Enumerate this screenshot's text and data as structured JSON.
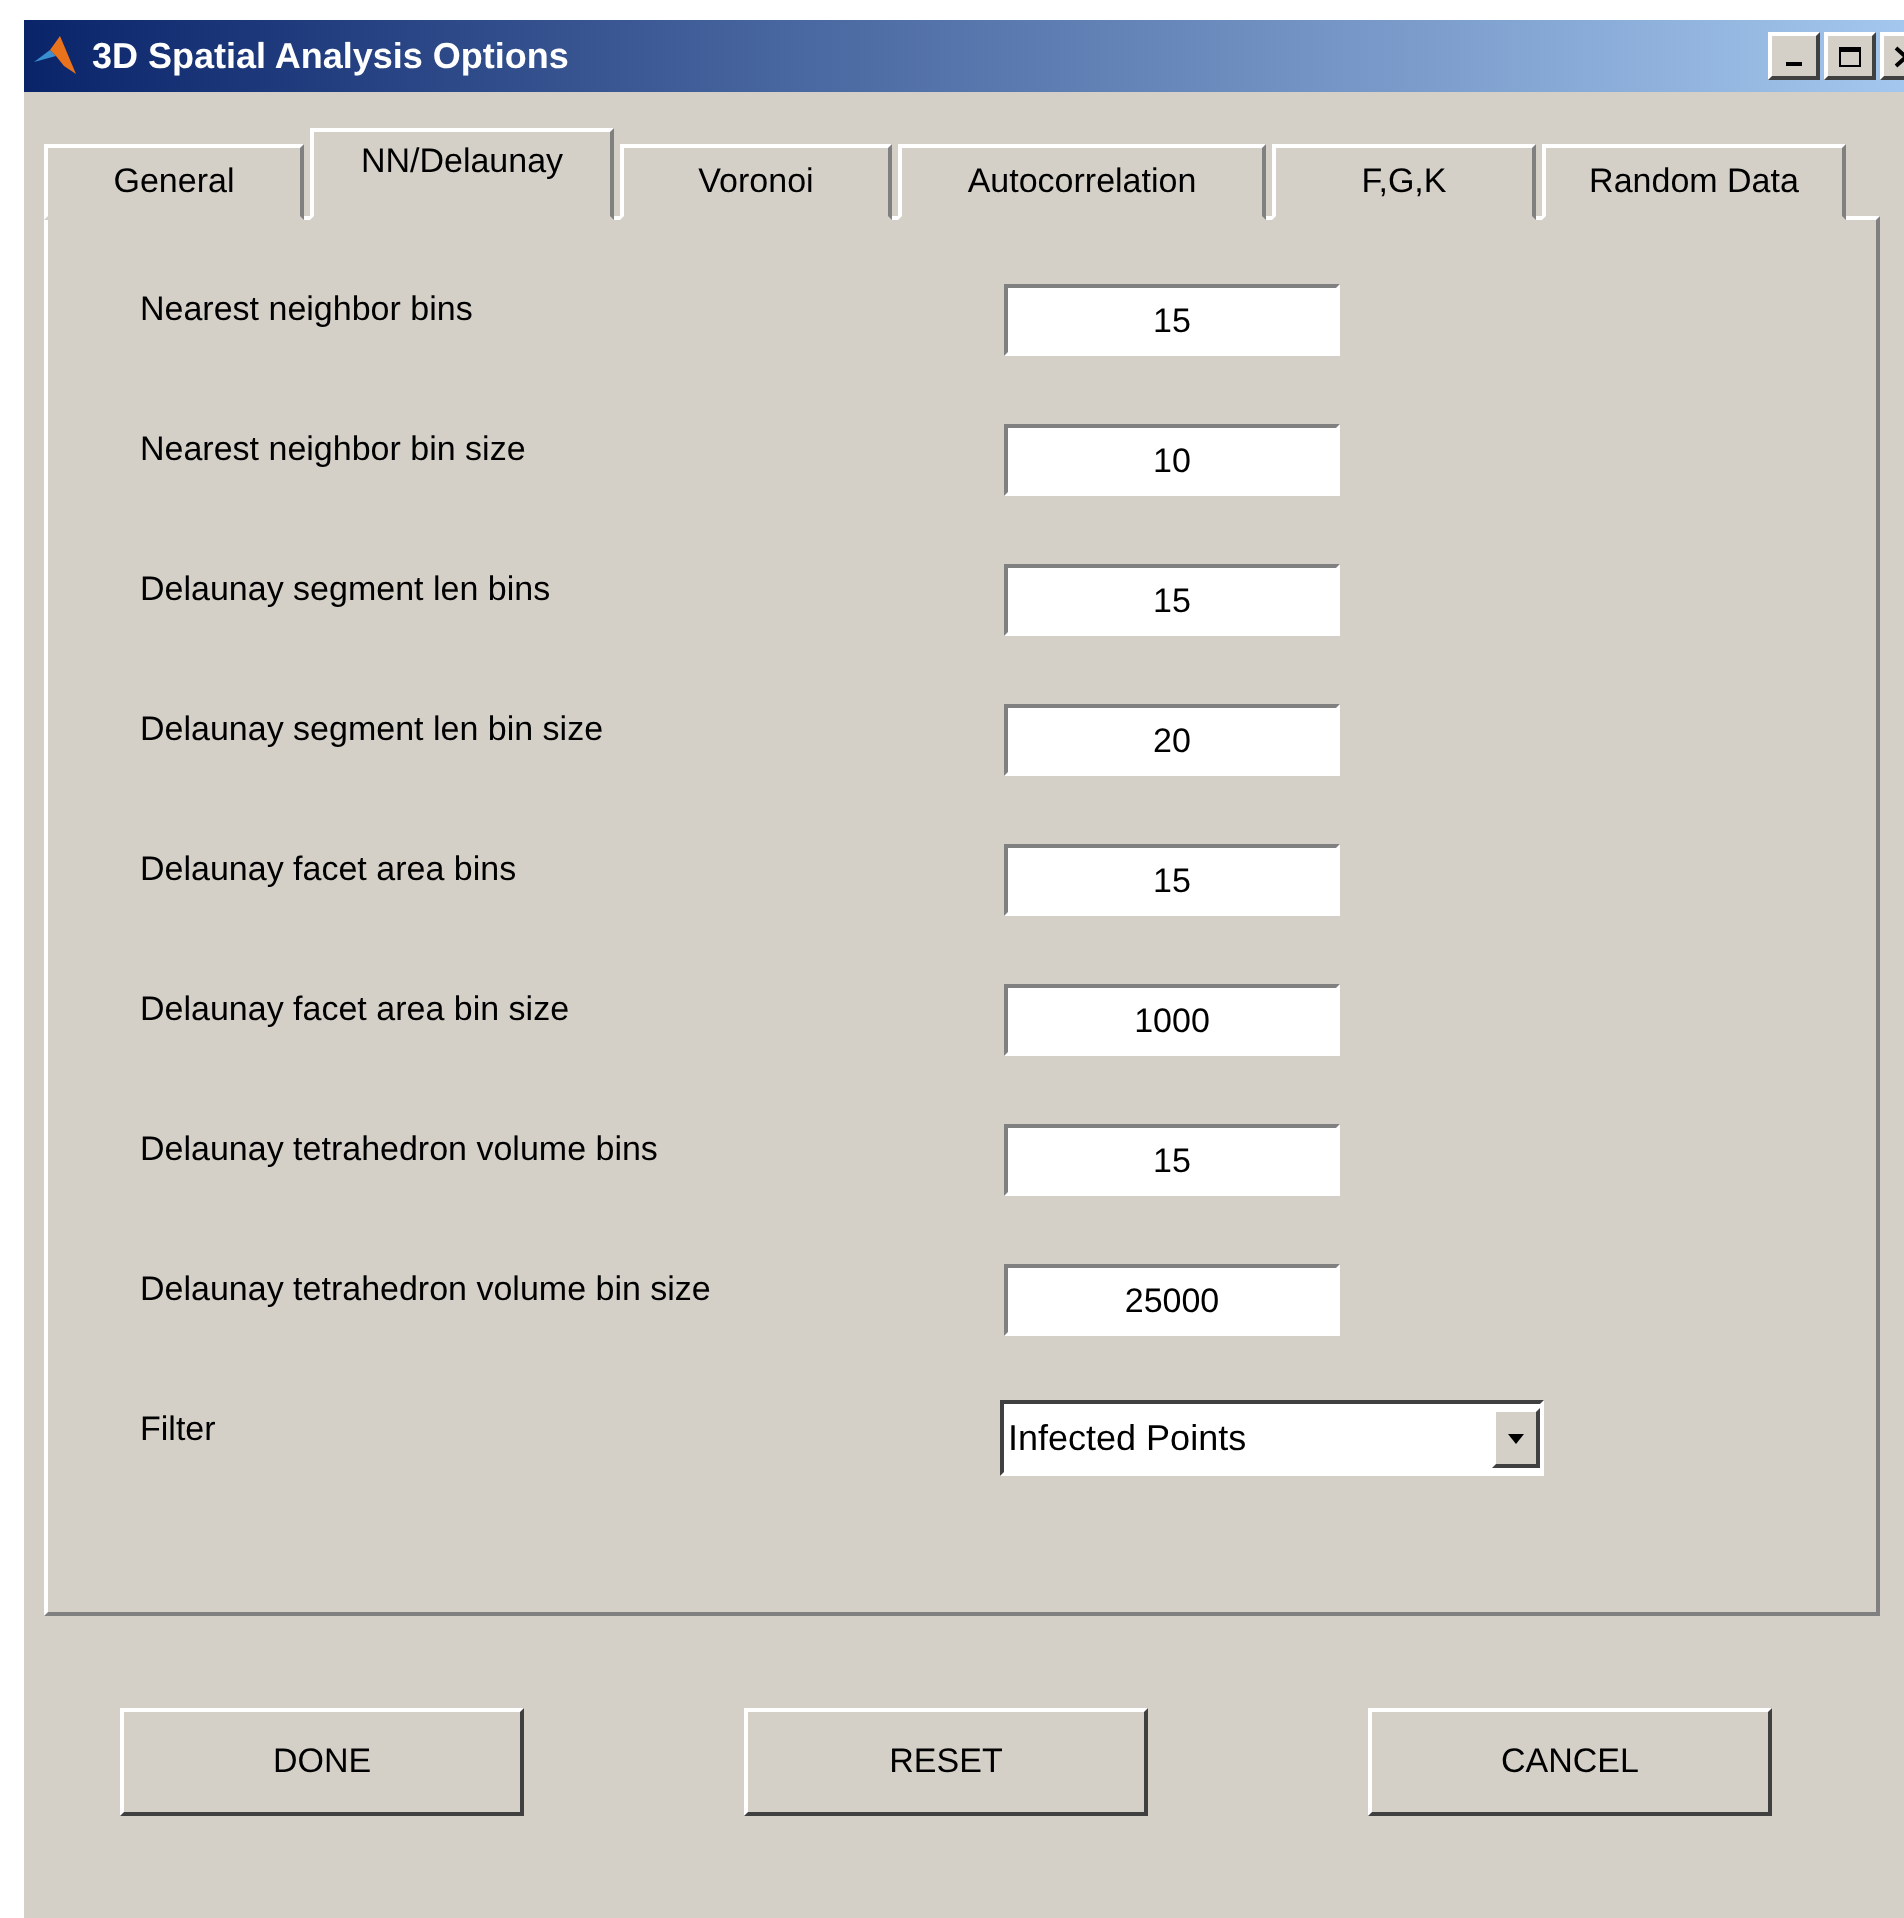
{
  "window": {
    "title": "3D Spatial Analysis Options"
  },
  "tabs": [
    {
      "label": "General",
      "selected": false
    },
    {
      "label": "NN/Delaunay",
      "selected": true
    },
    {
      "label": "Voronoi",
      "selected": false
    },
    {
      "label": "Autocorrelation",
      "selected": false
    },
    {
      "label": "F,G,K",
      "selected": false
    },
    {
      "label": "Random Data",
      "selected": false
    }
  ],
  "fields": [
    {
      "kind": "text",
      "label": "Nearest neighbor bins",
      "value": "15"
    },
    {
      "kind": "text",
      "label": "Nearest neighbor bin size",
      "value": "10"
    },
    {
      "kind": "text",
      "label": "Delaunay segment len bins",
      "value": "15"
    },
    {
      "kind": "text",
      "label": "Delaunay segment len bin size",
      "value": "20"
    },
    {
      "kind": "text",
      "label": "Delaunay facet area bins",
      "value": "15"
    },
    {
      "kind": "text",
      "label": "Delaunay facet area bin size",
      "value": "1000"
    },
    {
      "kind": "text",
      "label": "Delaunay tetrahedron volume bins",
      "value": "15"
    },
    {
      "kind": "text",
      "label": "Delaunay tetrahedron volume bin size",
      "value": "25000"
    },
    {
      "kind": "dropdown",
      "label": "Filter",
      "value": "Infected Points"
    }
  ],
  "buttons": [
    "DONE",
    "RESET",
    "CANCEL"
  ]
}
